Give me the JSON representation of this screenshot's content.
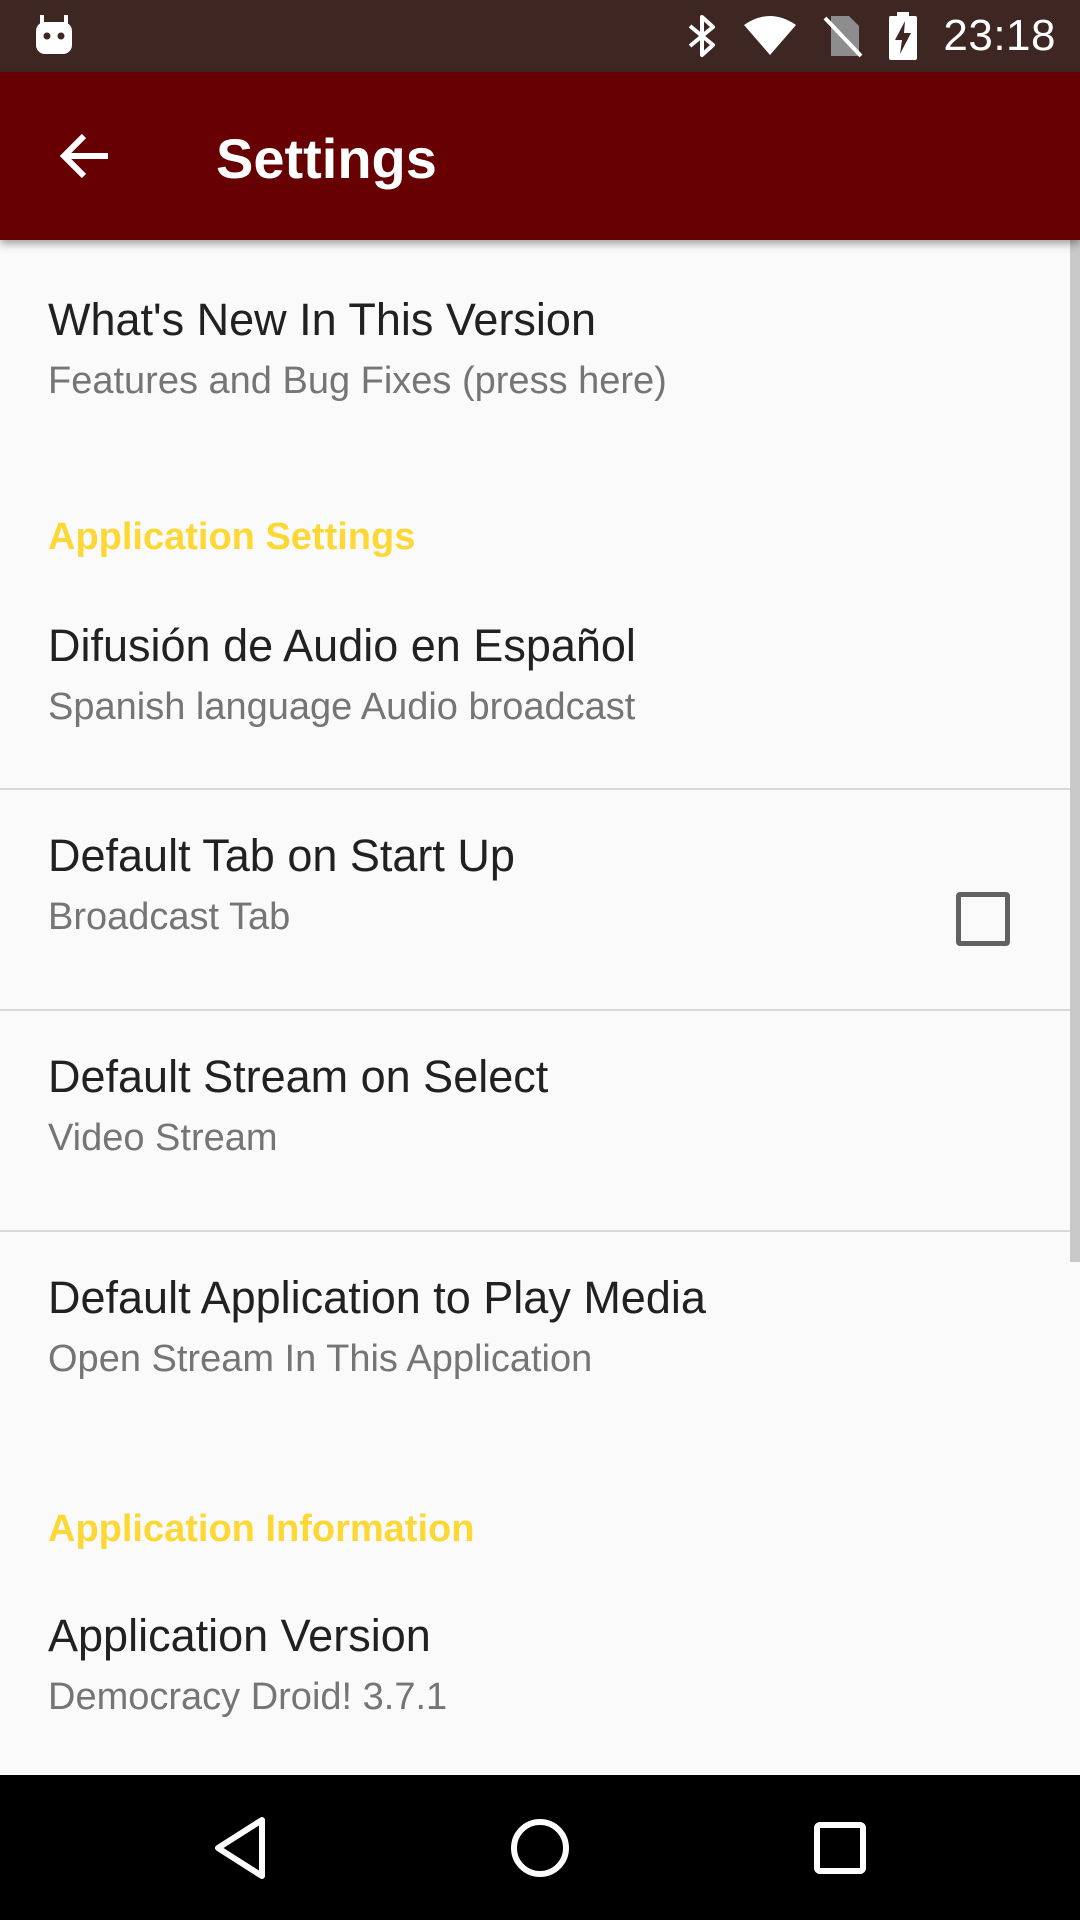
{
  "status_bar": {
    "time": "23:18",
    "icons": [
      "android-notification-icon",
      "bluetooth-icon",
      "wifi-icon",
      "no-sim-icon",
      "battery-charging-icon"
    ]
  },
  "app_bar": {
    "title": "Settings",
    "back_icon": "arrow-back-icon"
  },
  "preferences": {
    "whats_new": {
      "title": "What's New In This Version",
      "summary": "Features and Bug Fixes (press here)"
    },
    "category_app_settings": "Application Settings",
    "spanish_audio": {
      "title": "Difusión de Audio en Español",
      "summary": "Spanish language Audio broadcast",
      "checked": false
    },
    "default_tab": {
      "title": "Default Tab on Start Up",
      "summary": "Broadcast Tab"
    },
    "default_stream": {
      "title": "Default Stream on Select",
      "summary": "Video Stream"
    },
    "default_app": {
      "title": "Default Application to Play Media",
      "summary": "Open Stream In This Application"
    },
    "category_app_info": "Application Information",
    "app_version": {
      "title": "Application Version",
      "summary": "Democracy Droid! 3.7.1"
    }
  },
  "nav_bar": {
    "icons": [
      "back-triangle-icon",
      "home-circle-icon",
      "recents-square-icon"
    ]
  },
  "colors": {
    "status_bar": "#3e2723",
    "app_bar": "#670003",
    "category_accent": "#fdd835",
    "background": "#fafafa"
  }
}
